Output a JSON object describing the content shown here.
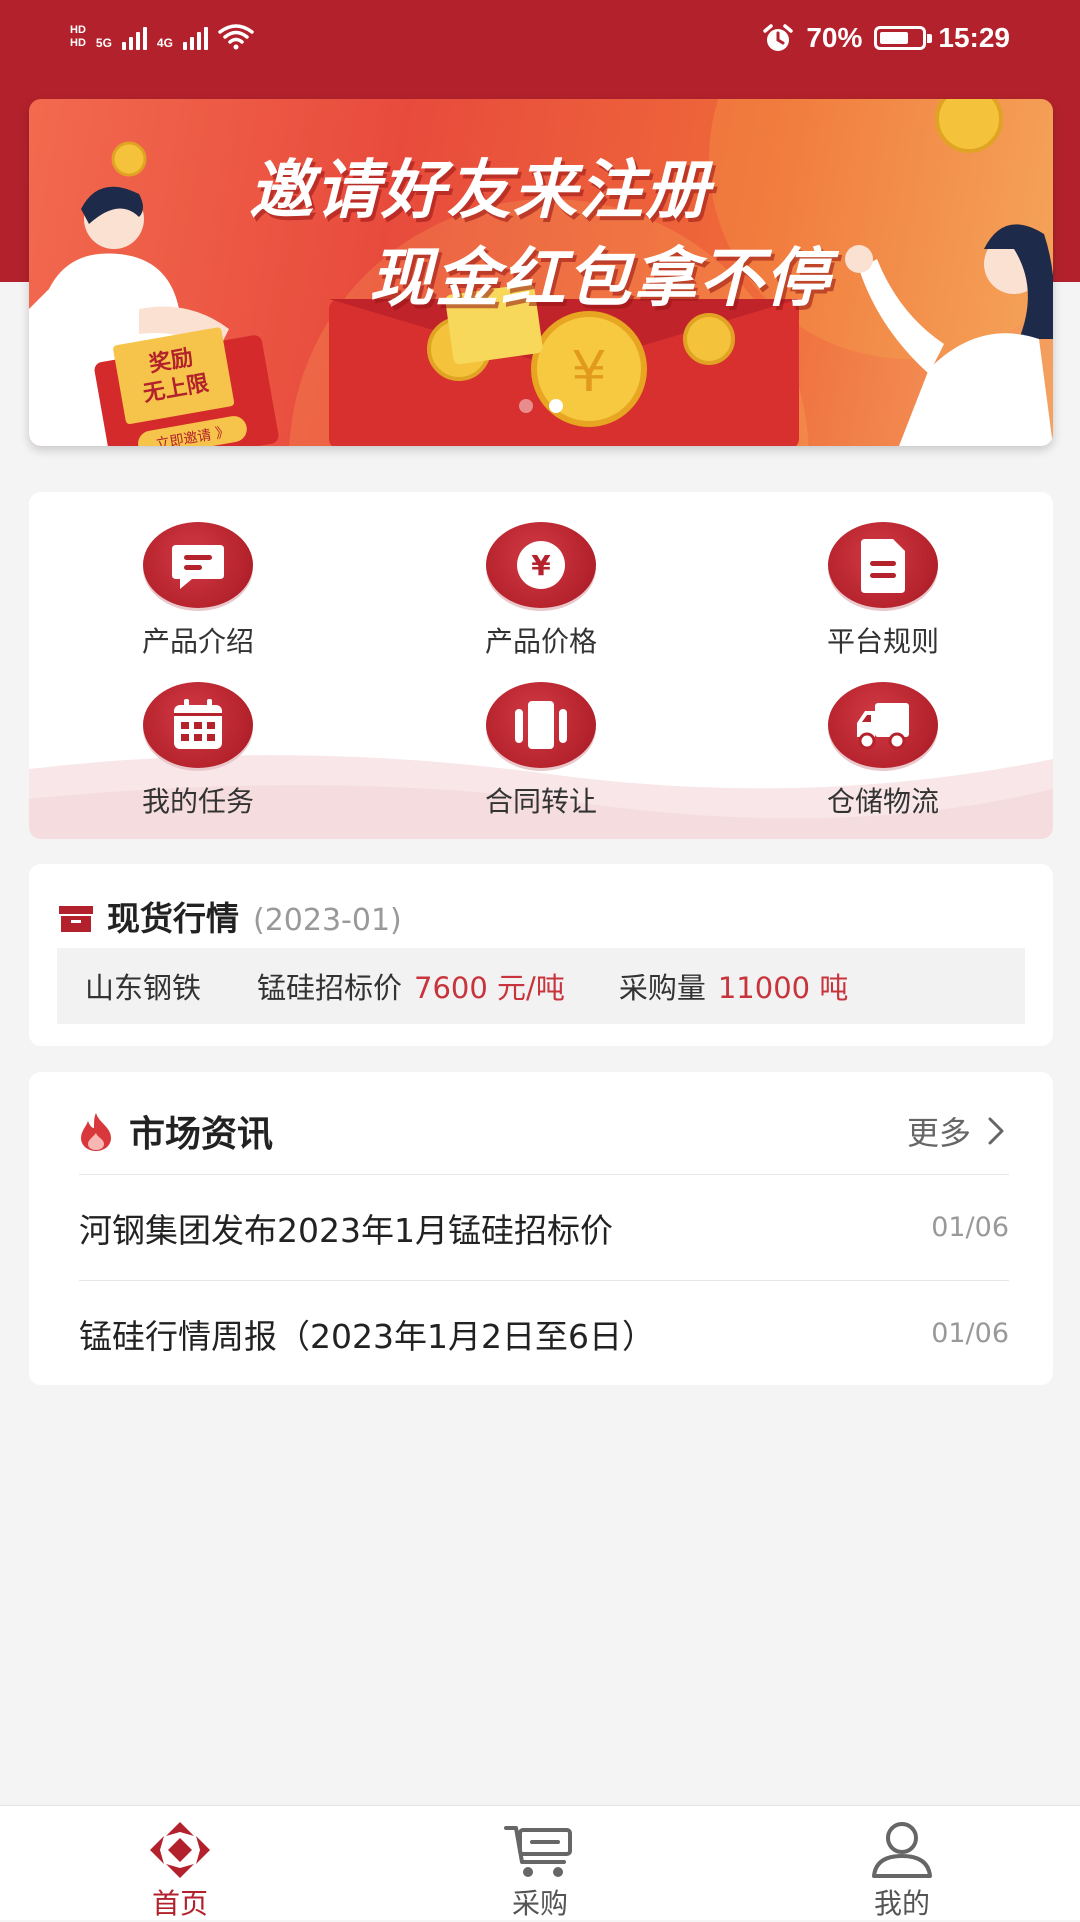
{
  "status_bar": {
    "hd1": "HD",
    "hd2": "HD",
    "net1": "5G",
    "net2": "4G",
    "battery_percent": "70%",
    "battery_level": 0.7,
    "time": "15:29"
  },
  "banner": {
    "title_line1": "邀请好友来注册",
    "title_line2": "现金红包拿不停",
    "card_text1": "奖励",
    "card_text2": "无上限",
    "card_button": "立即邀请 》",
    "slide_count": 2,
    "active_slide": 2
  },
  "menu": {
    "items": [
      {
        "label": "产品介绍",
        "icon": "chat-bubble-icon"
      },
      {
        "label": "产品价格",
        "icon": "yen-coin-icon"
      },
      {
        "label": "平台规则",
        "icon": "document-icon"
      },
      {
        "label": "我的任务",
        "icon": "calendar-icon"
      },
      {
        "label": "合同转让",
        "icon": "transfer-cards-icon"
      },
      {
        "label": "仓储物流",
        "icon": "truck-icon"
      }
    ]
  },
  "spot_market": {
    "title": "现货行情",
    "date": "(2023-01)",
    "company": "山东钢铁",
    "price_label": "锰硅招标价",
    "price_value": "7600 元/吨",
    "volume_label": "采购量",
    "volume_value": "11000 吨"
  },
  "news": {
    "title": "市场资讯",
    "more_label": "更多",
    "items": [
      {
        "title": "河钢集团发布2023年1月锰硅招标价",
        "date": "01/06"
      },
      {
        "title": "锰硅行情周报（2023年1月2日至6日）",
        "date": "01/06"
      }
    ]
  },
  "bottom_nav": {
    "items": [
      {
        "label": "首页",
        "icon": "home-logo-icon",
        "active": true
      },
      {
        "label": "采购",
        "icon": "cart-icon",
        "active": false
      },
      {
        "label": "我的",
        "icon": "user-icon",
        "active": false
      }
    ]
  },
  "colors": {
    "brand_red": "#b3222c",
    "price_red": "#c8343c",
    "background": "#f4f4f5"
  }
}
